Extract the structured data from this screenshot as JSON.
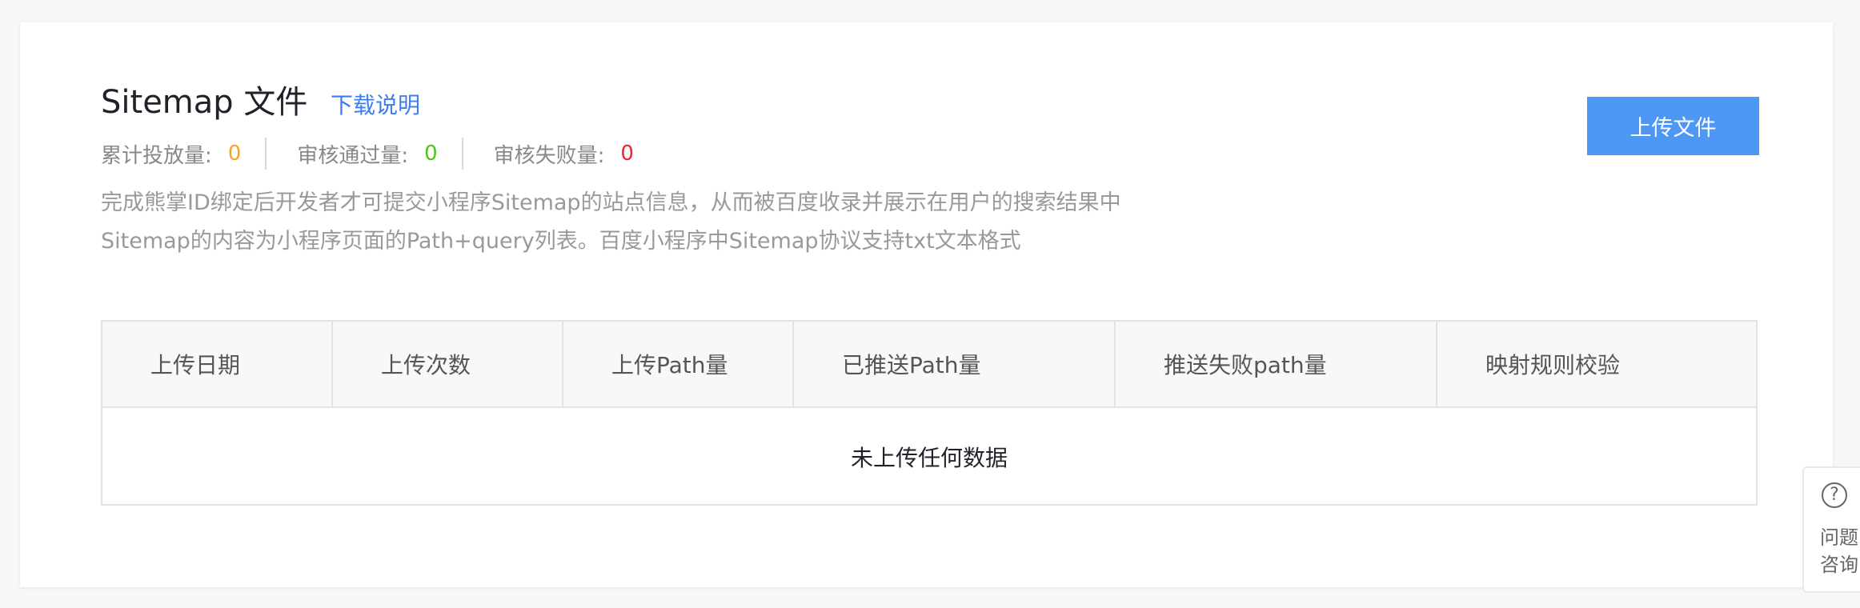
{
  "section": {
    "title": "Sitemap 文件",
    "download_link": "下载说明",
    "upload_button": "上传文件"
  },
  "stats": [
    {
      "label": "累计投放量:",
      "value": "0",
      "color": "#f5a623"
    },
    {
      "label": "审核通过量:",
      "value": "0",
      "color": "#52c41a"
    },
    {
      "label": "审核失败量:",
      "value": "0",
      "color": "#f5222d"
    }
  ],
  "description": {
    "line1": "完成熊掌ID绑定后开发者才可提交小程序Sitemap的站点信息，从而被百度收录并展示在用户的搜索结果中",
    "line2": "Sitemap的内容为小程序页面的Path+query列表。百度小程序中Sitemap协议支持txt文本格式"
  },
  "table": {
    "columns": [
      "上传日期",
      "上传次数",
      "上传Path量",
      "已推送Path量",
      "推送失败path量",
      "映射规则校验"
    ],
    "empty_text": "未上传任何数据"
  },
  "help_widget": {
    "icon": "question-circle-icon",
    "line1": "问题",
    "line2": "咨询"
  }
}
